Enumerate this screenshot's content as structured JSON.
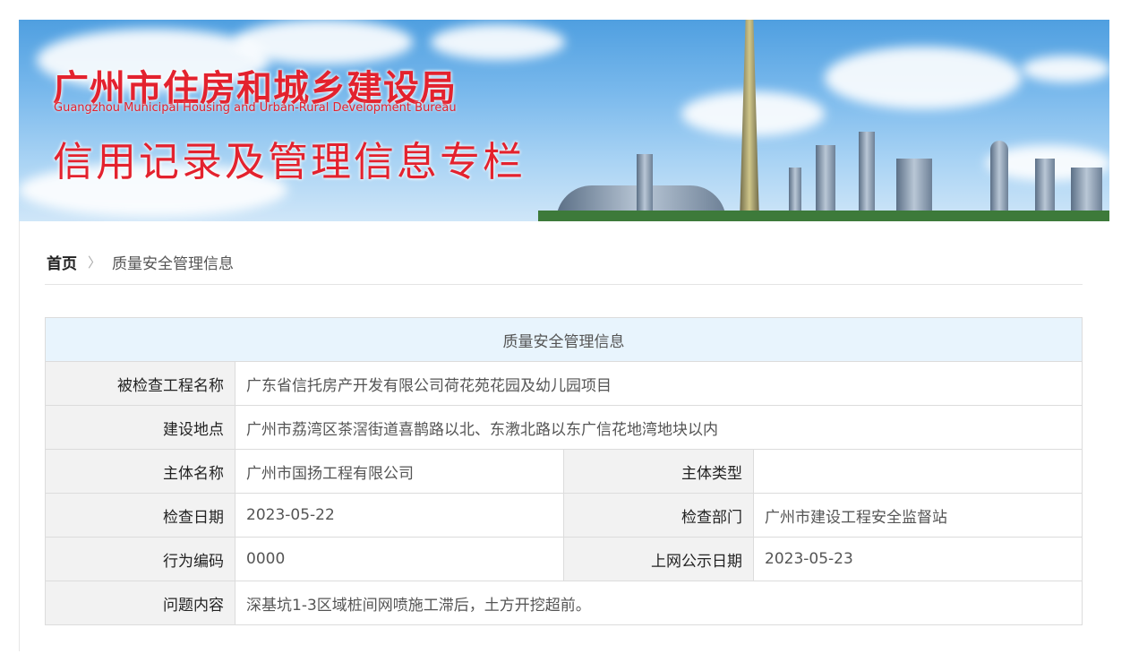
{
  "banner": {
    "title_cn": "广州市住房和城乡建设局",
    "title_en": "Guangzhou Municipal Housing and Urban-Rural Development Bureau",
    "subtitle": "信用记录及管理信息专栏"
  },
  "breadcrumb": {
    "home": "首页",
    "current": "质量安全管理信息"
  },
  "table": {
    "title": "质量安全管理信息",
    "project_name": {
      "label": "被检查工程名称",
      "value": "广东省信托房产开发有限公司荷花苑花园及幼儿园项目"
    },
    "location": {
      "label": "建设地点",
      "value": "广州市荔湾区茶滘街道喜鹊路以北、东漖北路以东广信花地湾地块以内"
    },
    "entity_name": {
      "label": "主体名称",
      "value": "广州市国扬工程有限公司"
    },
    "entity_type": {
      "label": "主体类型",
      "value": ""
    },
    "inspection_date": {
      "label": "检查日期",
      "value": "2023-05-22"
    },
    "department": {
      "label": "检查部门",
      "value": "广州市建设工程安全监督站"
    },
    "behavior_code": {
      "label": "行为编码",
      "value": "0000"
    },
    "publish_date": {
      "label": "上网公示日期",
      "value": "2023-05-23"
    },
    "issue": {
      "label": "问题内容",
      "value": "深基坑1-3区域桩间网喷施工滞后，土方开挖超前。"
    }
  }
}
